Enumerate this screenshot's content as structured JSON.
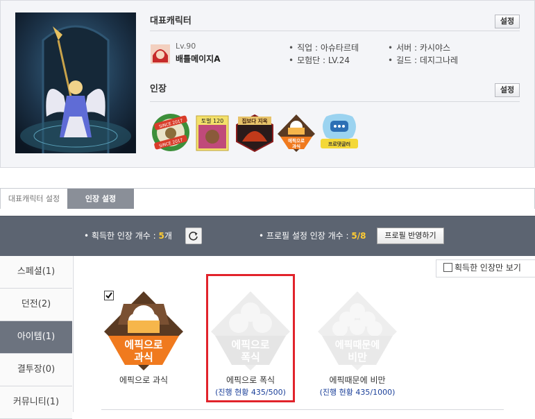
{
  "profile": {
    "rep_title": "대표캐릭터",
    "set_label": "설정",
    "level": "Lv.90",
    "char_name": "배틀메이지A",
    "job": "직업 : 아슈타르테",
    "adventure": "모험단 : LV.24",
    "server": "서버 : 카시야스",
    "guild": "길드 : 데지그나레",
    "badge_title": "인장",
    "badge_set_label": "설정",
    "badges": [
      "SINCE 2017",
      "토벌 120",
      "집보다 지옥",
      "에픽으로 과식",
      "프로댓글러"
    ]
  },
  "tabs": {
    "rep": "대표캐릭터 설정",
    "badge": "인장 설정"
  },
  "band": {
    "acquired_label": "획득한 인장 개수 :",
    "acquired_count": "5",
    "acquired_unit": "개",
    "profile_label": "프로필 설정 인장 개수 :",
    "profile_count": "5/8",
    "apply": "프로필 반영하기"
  },
  "menu": [
    "스페셜(1)",
    "던전(2)",
    "아이템(1)",
    "결투장(0)",
    "커뮤니티(1)"
  ],
  "filter": "획득한 인장만 보기",
  "items": [
    {
      "badge_text": "에픽으로\n과식",
      "label": "에픽으로 과식",
      "progress": ""
    },
    {
      "badge_text": "에픽으로\n폭식",
      "label": "에픽으로 폭식",
      "progress": "(진행 현황 435/500)"
    },
    {
      "badge_text": "에픽때문에\n비만",
      "label": "에픽때문에 비만",
      "progress": "(진행 현황 435/1000)"
    }
  ],
  "colors": {
    "band": "#5c6471",
    "accent_yellow": "#ffcc33",
    "active_menu": "#6c737f",
    "highlight": "#e1232b",
    "epic_orange": "#f07a1e"
  }
}
